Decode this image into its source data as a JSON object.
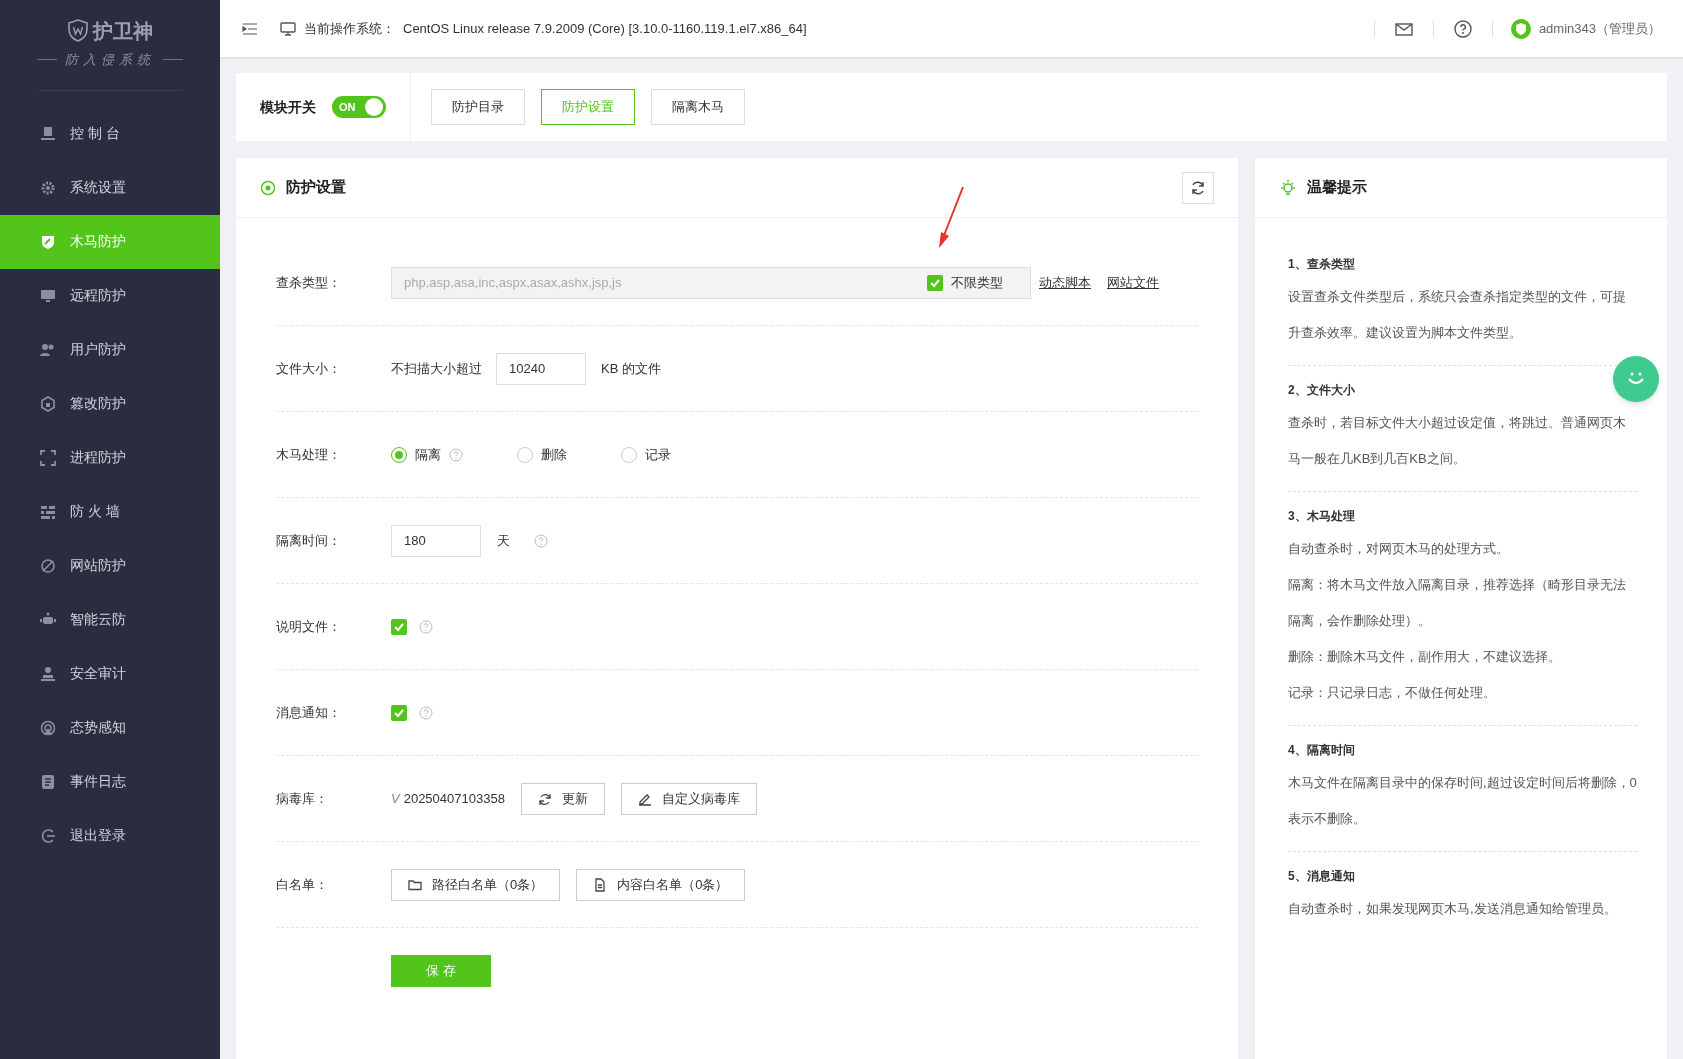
{
  "sidebar": {
    "logo_title": "护卫神",
    "logo_subtitle": "防入侵系统",
    "items": [
      {
        "label": "控 制 台",
        "selected": false
      },
      {
        "label": "系统设置",
        "selected": false
      },
      {
        "label": "木马防护",
        "selected": true
      },
      {
        "label": "远程防护",
        "selected": false
      },
      {
        "label": "用户防护",
        "selected": false
      },
      {
        "label": "篡改防护",
        "selected": false
      },
      {
        "label": "进程防护",
        "selected": false
      },
      {
        "label": "防 火 墙",
        "selected": false
      },
      {
        "label": "网站防护",
        "selected": false
      },
      {
        "label": "智能云防",
        "selected": false
      },
      {
        "label": "安全审计",
        "selected": false
      },
      {
        "label": "态势感知",
        "selected": false
      },
      {
        "label": "事件日志",
        "selected": false
      },
      {
        "label": "退出登录",
        "selected": false
      }
    ]
  },
  "header": {
    "os_label": "当前操作系统：",
    "os_value": "CentOS Linux release 7.9.2009 (Core) [3.10.0-1160.119.1.el7.x86_64]",
    "user": "admin343（管理员）"
  },
  "module": {
    "label": "模块开关",
    "switch": {
      "on": true,
      "text": "ON"
    },
    "tabs": [
      {
        "label": "防护目录",
        "selected": false
      },
      {
        "label": "防护设置",
        "selected": true
      },
      {
        "label": "隔离木马",
        "selected": false
      }
    ]
  },
  "settings": {
    "title": "防护设置",
    "rows": [
      {
        "kind": "types",
        "label": "查杀类型：",
        "value": "php,asp,asa,inc,aspx,asax,ashx,jsp,js",
        "disabled": true,
        "checkbox": {
          "label": "不限类型",
          "checked": true
        },
        "links": [
          "动态脚本",
          "网站文件"
        ]
      },
      {
        "kind": "size",
        "label": "文件大小：",
        "prefix": "不扫描大小超过",
        "value": "10240",
        "suffix": "KB 的文件"
      },
      {
        "kind": "radio",
        "label": "木马处理：",
        "options": [
          {
            "label": "隔离",
            "selected": true,
            "help": true
          },
          {
            "label": "删除",
            "selected": false,
            "help": false
          },
          {
            "label": "记录",
            "selected": false,
            "help": false
          }
        ]
      },
      {
        "kind": "days",
        "label": "隔离时间：",
        "value": "180",
        "suffix": "天"
      },
      {
        "kind": "check",
        "label": "说明文件：",
        "checked": true
      },
      {
        "kind": "check",
        "label": "消息通知：",
        "checked": true
      },
      {
        "kind": "virus",
        "label": "病毒库：",
        "version_mark": "V",
        "version": "20250407103358",
        "buttons": [
          {
            "kind": "refresh",
            "label": "更新"
          },
          {
            "kind": "edit",
            "label": "自定义病毒库"
          }
        ]
      },
      {
        "kind": "whitelist",
        "label": "白名单：",
        "buttons": [
          {
            "kind": "folder",
            "label": "路径白名单（0条）"
          },
          {
            "kind": "file",
            "label": "内容白名单（0条）"
          }
        ]
      }
    ],
    "save": "保 存"
  },
  "tips": {
    "title": "温馨提示",
    "sections": [
      {
        "title": "1、查杀类型",
        "paragraphs": [
          "设置查杀文件类型后，系统只会查杀指定类型的文件，可提升查杀效率。建议设置为脚本文件类型。"
        ]
      },
      {
        "title": "2、文件大小",
        "paragraphs": [
          "查杀时，若目标文件大小超过设定值，将跳过。普通网页木马一般在几KB到几百KB之间。"
        ]
      },
      {
        "title": "3、木马处理",
        "paragraphs": [
          "自动查杀时，对网页木马的处理方式。",
          "隔离：将木马文件放入隔离目录，推荐选择（畸形目录无法隔离，会作删除处理）。",
          "删除：删除木马文件，副作用大，不建议选择。",
          "记录：只记录日志，不做任何处理。"
        ]
      },
      {
        "title": "4、隔离时间",
        "paragraphs": [
          "木马文件在隔离目录中的保存时间,超过设定时间后将删除，0表示不删除。"
        ]
      },
      {
        "title": "5、消息通知",
        "paragraphs": [
          "自动查杀时，如果发现网页木马,发送消息通知给管理员。"
        ]
      }
    ]
  }
}
